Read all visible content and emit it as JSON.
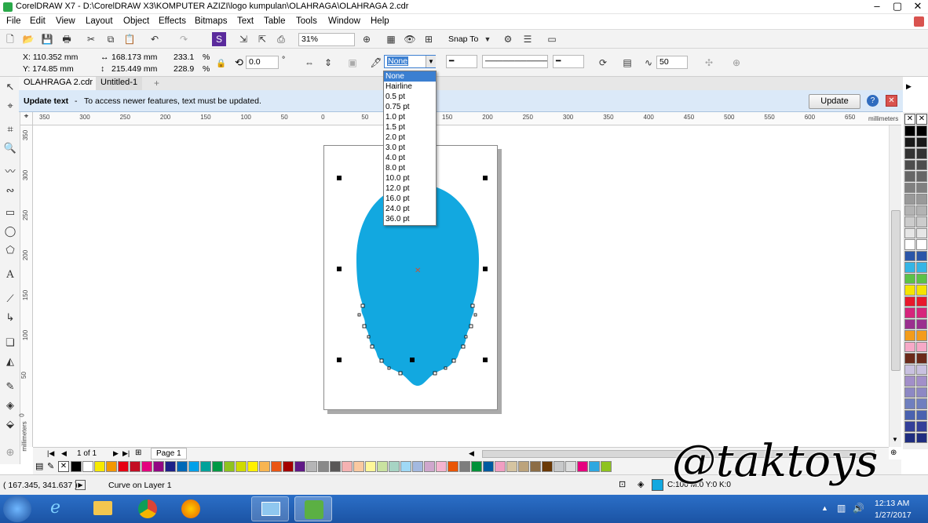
{
  "window": {
    "title": "CorelDRAW X7 - D:\\CorelDRAW X3\\KOMPUTER  AZIZI\\logo kumpulan\\OLAHRAGA\\OLAHRAGA 2.cdr"
  },
  "menu": [
    "File",
    "Edit",
    "View",
    "Layout",
    "Object",
    "Effects",
    "Bitmaps",
    "Text",
    "Table",
    "Tools",
    "Window",
    "Help"
  ],
  "standard_toolbar": {
    "zoom": "31%",
    "snap_to": "Snap To"
  },
  "property_bar": {
    "x": "X: 110.352 mm",
    "y": "Y: 174.85 mm",
    "width": "168.173 mm",
    "height": "215.449 mm",
    "scale_x": "233.1",
    "scale_y": "228.9",
    "percent": "%",
    "rotation": "0.0",
    "degree": "°",
    "outline_width": "None",
    "miter": "50"
  },
  "outline_dropdown": [
    "None",
    "Hairline",
    "0.5 pt",
    "0.75 pt",
    "1.0 pt",
    "1.5 pt",
    "2.0 pt",
    "3.0 pt",
    "4.0 pt",
    "8.0 pt",
    "10.0 pt",
    "12.0 pt",
    "16.0 pt",
    "24.0 pt",
    "36.0 pt"
  ],
  "tabs": [
    {
      "label": "OLAHRAGA 2.cdr"
    },
    {
      "label": "Untitled-1"
    }
  ],
  "infobar": {
    "title": "Update text",
    "message": "To access newer features, text must be updated.",
    "button": "Update"
  },
  "ruler": {
    "h_ticks": [
      "350",
      "300",
      "250",
      "200",
      "150",
      "100",
      "50",
      "0",
      "50",
      "100",
      "150",
      "200",
      "250",
      "300",
      "350",
      "400",
      "450",
      "500",
      "550",
      "600",
      "650"
    ],
    "h_unit": "millimeters",
    "v_ticks": [
      "350",
      "300",
      "250",
      "200",
      "150",
      "100",
      "50",
      "0"
    ],
    "v_unit": "millimeters"
  },
  "page_nav": {
    "counter": "1 of 1",
    "page": "Page 1"
  },
  "status": {
    "coords": "( 167.345, 341.637 )",
    "object": "Curve on Layer 1",
    "fill_info": "C:100 M:0 Y:0 K:0"
  },
  "clock": {
    "time": "12:13 AM",
    "date": "1/27/2017"
  },
  "watermark": "@taktoys",
  "colors": {
    "shape_fill": "#12a8e0",
    "palette_bottom": [
      "#000000",
      "#ffffff",
      "#f7ea00",
      "#f39800",
      "#e60012",
      "#c30d23",
      "#e4007f",
      "#920783",
      "#1d2088",
      "#0068b7",
      "#00a0e9",
      "#00a29a",
      "#009944",
      "#8fc31f",
      "#cfdb00",
      "#fff100",
      "#f8b551",
      "#ea5514",
      "#a40000",
      "#601986",
      "#b5b5b6",
      "#898989",
      "#595757",
      "#f5b2b2",
      "#fac9a0",
      "#fff799",
      "#c9e2a0",
      "#a7d4c4",
      "#9fd9f6",
      "#a3b9e0",
      "#cfa7cd",
      "#f4b4d0",
      "#e95504",
      "#7d7d7d",
      "#00913a",
      "#005aa0",
      "#f19ec2",
      "#d5c4a1",
      "#bca37b",
      "#8c6d46",
      "#6a3906",
      "#c8c9ca",
      "#dcdddd",
      "#e6007e",
      "#2ea7e0",
      "#8ec31f"
    ],
    "palette_right": [
      "#000000",
      "#1a1a1a",
      "#333333",
      "#4d4d4d",
      "#666666",
      "#808080",
      "#999999",
      "#b3b3b3",
      "#cccccc",
      "#e6e6e6",
      "#ffffff",
      "#2b56a8",
      "#35b5e5",
      "#5bc247",
      "#f5e400",
      "#e8192c",
      "#d6257c",
      "#9b2f8f",
      "#f39c1b",
      "#f6a9c7",
      "#6b2a1a",
      "#c9c1e0",
      "#a28fc9",
      "#8d88c4",
      "#6f7fbf",
      "#4a62b0",
      "#333f99",
      "#1f2d80"
    ]
  }
}
